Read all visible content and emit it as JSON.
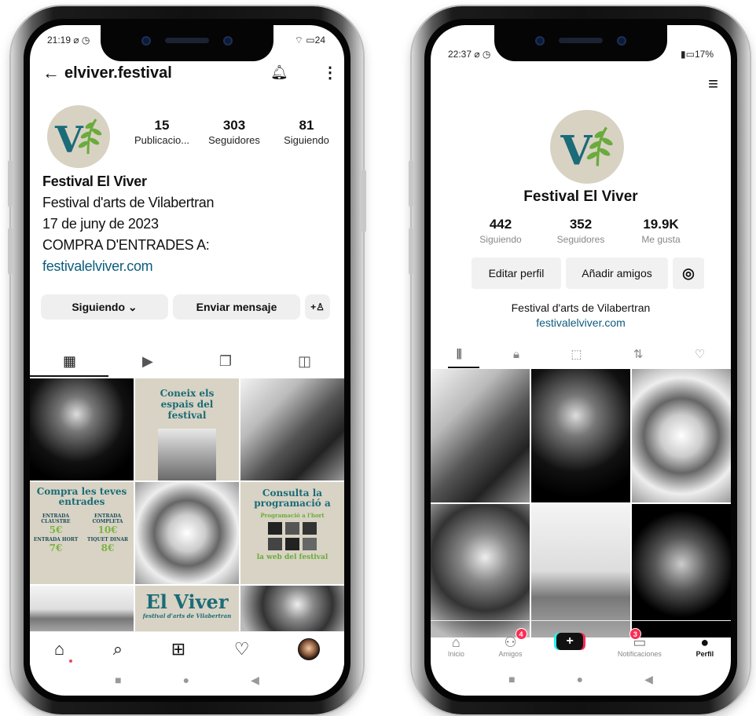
{
  "instagram": {
    "status_time": "21:19",
    "status_battery": "24",
    "back_icon": "arrow-left-icon",
    "username": "elviver.festival",
    "stats": [
      {
        "value": "15",
        "label": "Publicacio..."
      },
      {
        "value": "303",
        "label": "Seguidores"
      },
      {
        "value": "81",
        "label": "Siguiendo"
      }
    ],
    "display_name": "Festival El Viver",
    "bio_lines": [
      "Festival d'arts de Vilabertran",
      "17 de juny de 2023",
      "COMPRA D'ENTRADES A:"
    ],
    "link": "festivalelviver.com",
    "following_button": "Siguiendo",
    "message_button": "Enviar mensaje",
    "posts": {
      "conexi_title": "Coneix els espais del festival",
      "tickets_title": "Compra les teves entrades",
      "ticket1_label": "ENTRADA CLAUSTRE",
      "ticket1_price": "5€",
      "ticket2_label": "ENTRADA COMPLETA",
      "ticket2_price": "10€",
      "ticket3_label": "ENTRADA HORT",
      "ticket3_price": "7€",
      "ticket4_label": "TIQUET DINAR",
      "ticket4_price": "8€",
      "prog_title": "Consulta la programació a",
      "prog_sub": "Programació a l'hort",
      "prog_web": "la web del festival",
      "logo_text": "El Viver",
      "logo_sub": "festival d'arts de Vilabertran"
    }
  },
  "tiktok": {
    "status_time": "22:37",
    "status_battery": "17",
    "profile_name": "Festival El Viver",
    "stats": [
      {
        "value": "442",
        "label": "Siguiendo"
      },
      {
        "value": "352",
        "label": "Seguidores"
      },
      {
        "value": "19.9K",
        "label": "Me gusta"
      }
    ],
    "edit_button": "Editar perfil",
    "add_friends_button": "Añadir amigos",
    "bio": "Festival d'arts de Vilabertran",
    "link": "festivalelviver.com",
    "nav": [
      {
        "label": "Inicio",
        "icon": "home-icon"
      },
      {
        "label": "Amigos",
        "icon": "friends-icon",
        "badge": "4"
      },
      {
        "label": "",
        "icon": "plus-icon"
      },
      {
        "label": "Notificaciones",
        "icon": "inbox-icon",
        "badge": "3"
      },
      {
        "label": "Perfil",
        "icon": "person-icon"
      }
    ]
  },
  "colors": {
    "link": "#0d5c7e",
    "brand_teal": "#1b6b78",
    "leaf_green": "#6aab3c",
    "tiktok_red": "#fe2c55",
    "beige": "#d8d3c4"
  }
}
